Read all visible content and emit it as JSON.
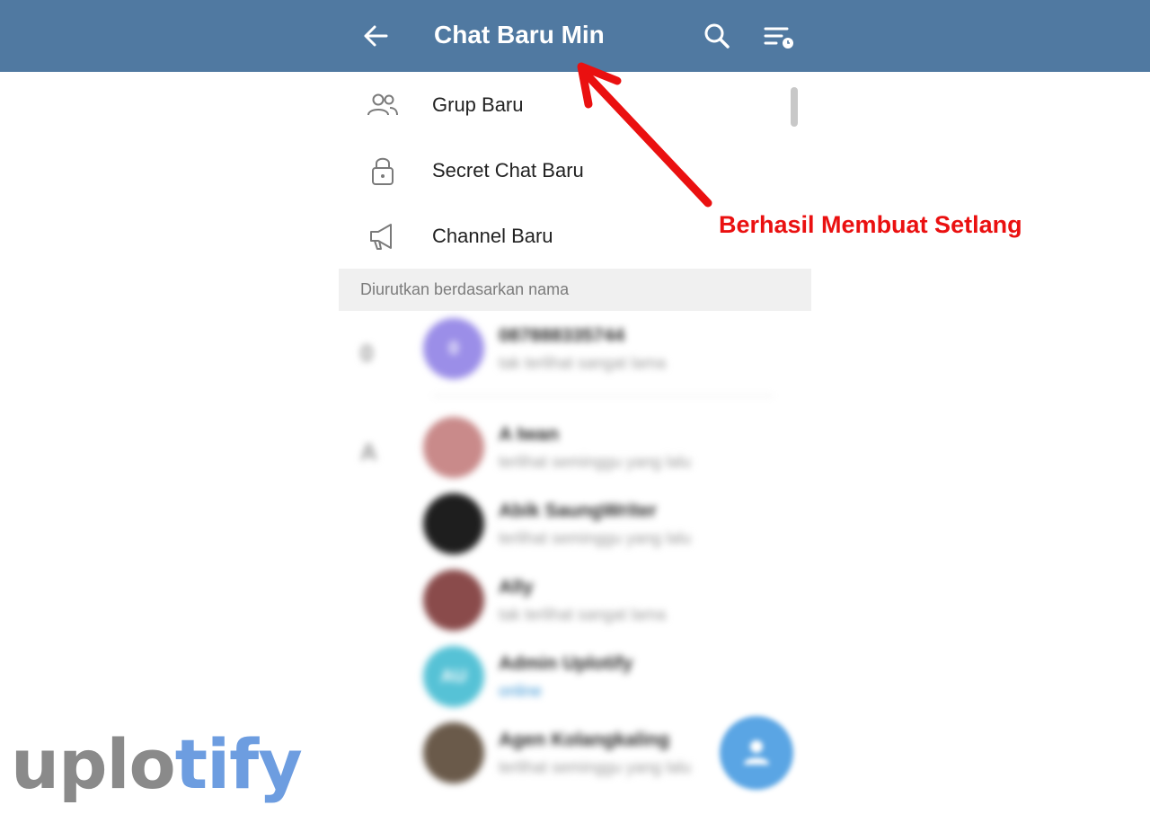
{
  "header": {
    "title": "Chat Baru Min",
    "back_icon": "arrow-left-icon",
    "search_icon": "search-icon",
    "sort_icon": "sort-by-time-icon",
    "background_color": "#5079a1"
  },
  "menu": {
    "items": [
      {
        "label": "Grup Baru",
        "icon": "group-icon"
      },
      {
        "label": "Secret Chat Baru",
        "icon": "lock-icon"
      },
      {
        "label": "Channel Baru",
        "icon": "megaphone-icon"
      }
    ]
  },
  "section": {
    "header": "Diurutkan berdasarkan nama"
  },
  "contacts": {
    "groups": [
      {
        "letter": "0"
      },
      {
        "letter": "A"
      }
    ],
    "items": [
      {
        "name": "087888335744",
        "status": "tak terlihat sangat lama",
        "avatar_text": "0",
        "avatar_color": "#9b8ee8"
      },
      {
        "name": "A Iwan",
        "status": "terlihat seminggu yang lalu",
        "avatar_text": "",
        "avatar_color": "#c98a8a"
      },
      {
        "name": "Abik SaungWriter",
        "status": "terlihat seminggu yang lalu",
        "avatar_text": "",
        "avatar_color": "#1e1e1e"
      },
      {
        "name": "Ally",
        "status": "tak terlihat sangat lama",
        "avatar_text": "",
        "avatar_color": "#8a4b4b"
      },
      {
        "name": "Admin Uplotify",
        "status": "online",
        "avatar_text": "AU",
        "avatar_color": "#56c2d6"
      },
      {
        "name": "Agen Kolangkaling",
        "status": "terlihat seminggu yang lalu",
        "avatar_text": "",
        "avatar_color": "#6a5a4a"
      }
    ]
  },
  "fab": {
    "icon": "add-contact-icon",
    "color": "#5aa5e4"
  },
  "annotation": {
    "text": "Berhasil Membuat Setlang",
    "color": "#ea1010"
  },
  "logo": {
    "part1": "uplo",
    "part2": "tify"
  }
}
